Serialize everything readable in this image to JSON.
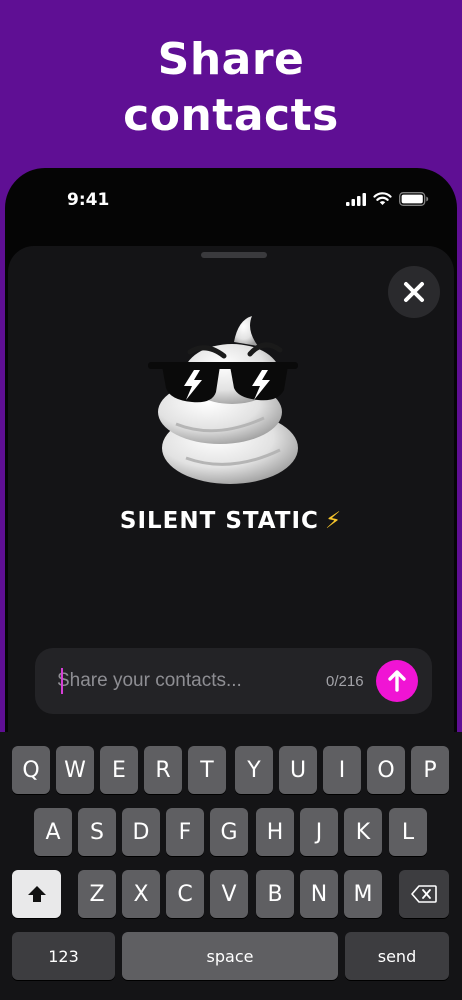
{
  "headline": {
    "line1": "Share",
    "line2": "contacts"
  },
  "status_bar": {
    "time": "9:41"
  },
  "profile": {
    "name": "SILENT STATIC",
    "name_emoji": "⚡"
  },
  "composer": {
    "placeholder": "Share your contacts...",
    "counter": "0/216"
  },
  "keyboard": {
    "row1": [
      "Q",
      "W",
      "E",
      "R",
      "T",
      "Y",
      "U",
      "I",
      "O",
      "P"
    ],
    "row2": [
      "A",
      "S",
      "D",
      "F",
      "G",
      "H",
      "J",
      "K",
      "L"
    ],
    "row3": [
      "Z",
      "X",
      "C",
      "V",
      "B",
      "N",
      "M"
    ],
    "numbers_label": "123",
    "space_label": "space",
    "send_label": "send"
  },
  "colors": {
    "background": "#5f0f94",
    "send_button": "#f014d4",
    "sheet": "#141416"
  }
}
